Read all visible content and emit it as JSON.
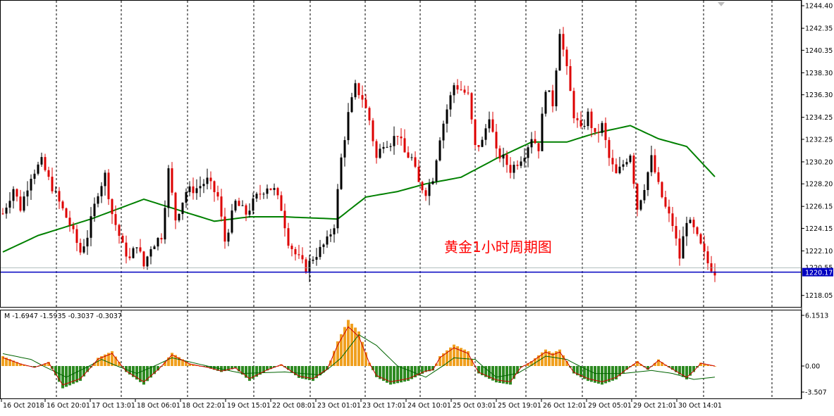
{
  "chart_data": [
    {
      "type": "candlestick",
      "title": "",
      "annotation": "黄金1小时周期图",
      "ylim": [
        1217.2,
        1244.6
      ],
      "y_ticks": [
        1244.4,
        1242.35,
        1240.35,
        1238.3,
        1236.3,
        1234.25,
        1232.25,
        1230.2,
        1228.2,
        1226.15,
        1224.15,
        1222.1,
        1218.05
      ],
      "x_ticks": [
        "16 Oct 2018",
        "16 Oct 20:01",
        "17 Oct 13:01",
        "18 Oct 06:01",
        "18 Oct 22:01",
        "19 Oct 15:01",
        "22 Oct 08:01",
        "23 Oct 01:01",
        "23 Oct 17:01",
        "24 Oct 10:01",
        "25 Oct 03:01",
        "25 Oct 19:01",
        "26 Oct 12:01",
        "29 Oct 05:01",
        "29 Oct 21:01",
        "30 Oct 14:01"
      ],
      "price_labels": {
        "ask": "1220.55",
        "bid": "1220.17"
      },
      "horizontal_line": 1220.17,
      "grid": "vertical dashed",
      "close_path": [
        [
          0,
          1225.5
        ],
        [
          3,
          1227.8
        ],
        [
          5,
          1226.0
        ],
        [
          8,
          1229.0
        ],
        [
          11,
          1230.2
        ],
        [
          13,
          1228.6
        ],
        [
          16,
          1226.5
        ],
        [
          19,
          1224.5
        ],
        [
          22,
          1222.0
        ],
        [
          24,
          1223.5
        ],
        [
          27,
          1227.5
        ],
        [
          29,
          1229.0
        ],
        [
          31,
          1225.5
        ],
        [
          34,
          1222.5
        ],
        [
          36,
          1221.3
        ],
        [
          38,
          1222.8
        ],
        [
          40,
          1220.7
        ],
        [
          42,
          1222.5
        ],
        [
          45,
          1223.5
        ],
        [
          47,
          1229.4
        ],
        [
          49,
          1225.0
        ],
        [
          52,
          1227.5
        ],
        [
          55,
          1227.8
        ],
        [
          58,
          1228.5
        ],
        [
          61,
          1227.0
        ],
        [
          63,
          1223.0
        ],
        [
          66,
          1226.5
        ],
        [
          69,
          1225.5
        ],
        [
          72,
          1227.0
        ],
        [
          75,
          1228.0
        ],
        [
          77,
          1227.6
        ],
        [
          79,
          1226.0
        ],
        [
          81,
          1223.0
        ],
        [
          83,
          1221.8
        ],
        [
          86,
          1220.5
        ],
        [
          88,
          1221.5
        ],
        [
          90,
          1222.2
        ],
        [
          92,
          1223.0
        ],
        [
          94,
          1224.5
        ],
        [
          96,
          1230.5
        ],
        [
          98,
          1234.5
        ],
        [
          100,
          1237.0
        ],
        [
          102,
          1236.0
        ],
        [
          104,
          1234.0
        ],
        [
          106,
          1230.5
        ],
        [
          108,
          1232.0
        ],
        [
          110,
          1232.0
        ],
        [
          112,
          1232.8
        ],
        [
          114,
          1231.0
        ],
        [
          116,
          1230.5
        ],
        [
          118,
          1228.2
        ],
        [
          120,
          1227.5
        ],
        [
          122,
          1228.8
        ],
        [
          124,
          1232.5
        ],
        [
          126,
          1235.0
        ],
        [
          128,
          1237.2
        ],
        [
          130,
          1236.8
        ],
        [
          132,
          1236.2
        ],
        [
          134,
          1231.5
        ],
        [
          136,
          1232.0
        ],
        [
          138,
          1234.5
        ],
        [
          140,
          1231.0
        ],
        [
          142,
          1230.5
        ],
        [
          144,
          1229.5
        ],
        [
          146,
          1230.2
        ],
        [
          148,
          1231.0
        ],
        [
          150,
          1232.5
        ],
        [
          152,
          1231.5
        ],
        [
          154,
          1237.0
        ],
        [
          156,
          1235.5
        ],
        [
          158,
          1242.2
        ],
        [
          160,
          1238.5
        ],
        [
          162,
          1234.5
        ],
        [
          164,
          1233.0
        ],
        [
          166,
          1234.5
        ],
        [
          168,
          1232.5
        ],
        [
          170,
          1233.5
        ],
        [
          172,
          1230.5
        ],
        [
          174,
          1229.0
        ],
        [
          176,
          1230.0
        ],
        [
          178,
          1231.0
        ],
        [
          180,
          1226.0
        ],
        [
          182,
          1228.0
        ],
        [
          184,
          1230.5
        ],
        [
          186,
          1228.0
        ],
        [
          188,
          1226.0
        ],
        [
          190,
          1224.5
        ],
        [
          192,
          1221.5
        ],
        [
          194,
          1225.0
        ],
        [
          196,
          1224.0
        ],
        [
          198,
          1222.5
        ],
        [
          200,
          1221.0
        ],
        [
          202,
          1220.2
        ]
      ],
      "series": [
        {
          "name": "",
          "type": "moving-average",
          "color": "#008000",
          "points": [
            [
              0,
              1222.0
            ],
            [
              10,
              1223.5
            ],
            [
              25,
              1225.0
            ],
            [
              40,
              1226.8
            ],
            [
              60,
              1224.8
            ],
            [
              70,
              1225.2
            ],
            [
              80,
              1225.2
            ],
            [
              95,
              1225.0
            ],
            [
              103,
              1227.0
            ],
            [
              112,
              1227.5
            ],
            [
              120,
              1228.2
            ],
            [
              130,
              1228.8
            ],
            [
              140,
              1230.5
            ],
            [
              150,
              1232.0
            ],
            [
              160,
              1232.0
            ],
            [
              168,
              1232.8
            ],
            [
              178,
              1233.5
            ],
            [
              186,
              1232.3
            ],
            [
              194,
              1231.6
            ],
            [
              203,
              1228.5
            ]
          ]
        }
      ],
      "colors": {
        "bull": "#000000",
        "bear": "#dd0000",
        "ma": "#008000",
        "level_line": "#0000c0",
        "annotation": "#ff0000"
      }
    },
    {
      "type": "histogram",
      "indicator_label": "M -1.6947 -1.5935 -0.3037 -0.3037",
      "ylim": [
        -3.507,
        6.1513
      ],
      "y_ticks": [
        "6.1513",
        "0.00",
        "-3.507"
      ],
      "bar_colors": {
        "positive": "#f0a020",
        "negative": "#2e8b22"
      },
      "values_path": [
        [
          0,
          1.2
        ],
        [
          5,
          0.3
        ],
        [
          9,
          -0.2
        ],
        [
          13,
          0.5
        ],
        [
          17,
          -3.0
        ],
        [
          22,
          -2.0
        ],
        [
          27,
          1.0
        ],
        [
          31,
          1.8
        ],
        [
          35,
          -0.8
        ],
        [
          40,
          -2.5
        ],
        [
          44,
          -0.6
        ],
        [
          48,
          1.6
        ],
        [
          53,
          0.3
        ],
        [
          58,
          -0.2
        ],
        [
          62,
          -0.8
        ],
        [
          66,
          -0.3
        ],
        [
          70,
          -2.0
        ],
        [
          75,
          -0.6
        ],
        [
          79,
          0.2
        ],
        [
          84,
          -1.6
        ],
        [
          88,
          -2.0
        ],
        [
          92,
          -0.5
        ],
        [
          95,
          3.0
        ],
        [
          98,
          5.6
        ],
        [
          101,
          4.2
        ],
        [
          104,
          0.4
        ],
        [
          106,
          -1.5
        ],
        [
          110,
          -2.5
        ],
        [
          115,
          -2.0
        ],
        [
          120,
          -0.8
        ],
        [
          122,
          -0.6
        ],
        [
          124,
          1.2
        ],
        [
          128,
          2.6
        ],
        [
          132,
          1.8
        ],
        [
          135,
          -1.0
        ],
        [
          140,
          -2.2
        ],
        [
          144,
          -2.5
        ],
        [
          147,
          -0.2
        ],
        [
          150,
          0.6
        ],
        [
          154,
          2.0
        ],
        [
          156,
          1.6
        ],
        [
          158,
          2.0
        ],
        [
          160,
          0.6
        ],
        [
          162,
          -1.0
        ],
        [
          166,
          -2.0
        ],
        [
          170,
          -2.5
        ],
        [
          174,
          -1.8
        ],
        [
          177,
          -0.5
        ],
        [
          180,
          0.6
        ],
        [
          183,
          -0.5
        ],
        [
          186,
          0.8
        ],
        [
          190,
          -0.5
        ],
        [
          194,
          -1.8
        ],
        [
          196,
          -0.8
        ],
        [
          198,
          0.4
        ],
        [
          202,
          0.0
        ]
      ],
      "signal_path": [
        [
          0,
          1.5
        ],
        [
          8,
          0.8
        ],
        [
          18,
          -1.5
        ],
        [
          28,
          0.8
        ],
        [
          38,
          -1.0
        ],
        [
          48,
          1.0
        ],
        [
          58,
          0.0
        ],
        [
          68,
          -1.0
        ],
        [
          80,
          -0.8
        ],
        [
          90,
          -1.2
        ],
        [
          96,
          1.0
        ],
        [
          101,
          3.8
        ],
        [
          106,
          2.5
        ],
        [
          112,
          0.0
        ],
        [
          120,
          -1.5
        ],
        [
          128,
          1.0
        ],
        [
          134,
          0.8
        ],
        [
          140,
          -1.5
        ],
        [
          146,
          -1.0
        ],
        [
          154,
          1.2
        ],
        [
          160,
          0.8
        ],
        [
          168,
          -1.0
        ],
        [
          176,
          -1.0
        ],
        [
          184,
          -0.6
        ],
        [
          190,
          -1.0
        ],
        [
          196,
          -1.8
        ],
        [
          202,
          -1.5
        ]
      ],
      "line_colors": {
        "main": "#cc0000",
        "signal": "#006400"
      }
    }
  ]
}
